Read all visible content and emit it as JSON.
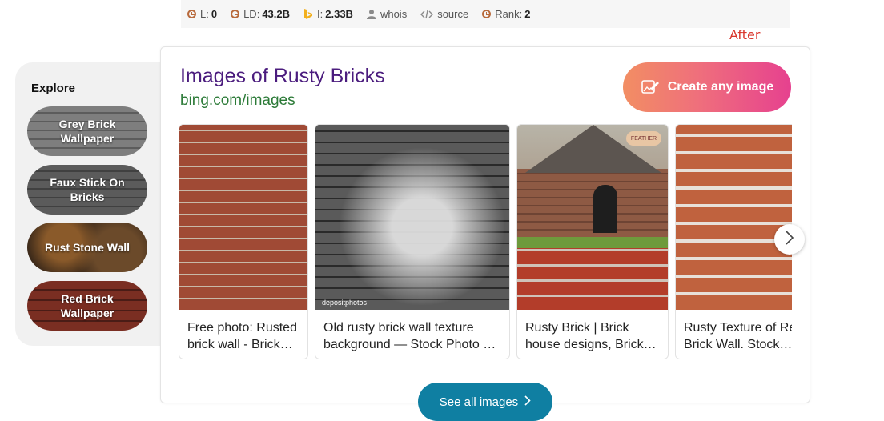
{
  "stats": {
    "l_label": "L:",
    "l_value": "0",
    "ld_label": "LD:",
    "ld_value": "43.2B",
    "i_label": "I:",
    "i_value": "2.33B",
    "whois_label": "whois",
    "source_label": "source",
    "rank_label": "Rank:",
    "rank_value": "2"
  },
  "after_label": "After",
  "explore": {
    "title": "Explore",
    "items": [
      {
        "label": "Grey Brick Wallpaper"
      },
      {
        "label": "Faux Stick On Bricks"
      },
      {
        "label": "Rust Stone Wall"
      },
      {
        "label": "Red Brick Wallpaper"
      }
    ]
  },
  "card": {
    "title": "Images of Rusty Bricks",
    "url": "bing.com/images",
    "create_label": "Create any image",
    "see_all_label": "See all images",
    "images": [
      {
        "line1": "Free photo: Rusted",
        "line2": "brick wall - Brick…"
      },
      {
        "line1": "Old rusty brick wall texture",
        "line2": "background — Stock Photo …",
        "watermark": "depositphotos"
      },
      {
        "line1": "Rusty Brick | Brick",
        "line2": "house designs, Brick…",
        "logo": "FEATHER"
      },
      {
        "line1": "Rusty Texture of Re",
        "line2": "Brick Wall. Stock…"
      }
    ]
  },
  "colors": {
    "title": "#4b1c7e",
    "url": "#2b7a37",
    "see_all_bg": "#0f7fa2",
    "after": "#d9352b"
  }
}
